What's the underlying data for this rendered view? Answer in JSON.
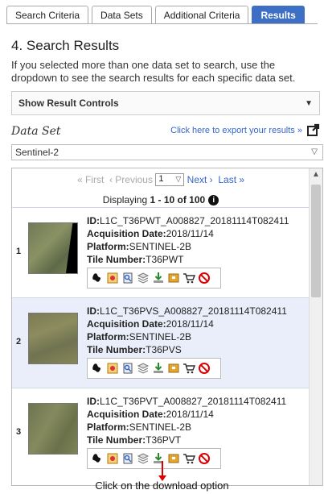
{
  "tabs": [
    {
      "label": "Search Criteria",
      "active": false
    },
    {
      "label": "Data Sets",
      "active": false
    },
    {
      "label": "Additional Criteria",
      "active": false
    },
    {
      "label": "Results",
      "active": true
    }
  ],
  "heading": "4. Search Results",
  "intro": "If you selected more than one data set to search, use the dropdown to see the search results for each specific data set.",
  "result_controls_label": "Show Result Controls",
  "dataset": {
    "label": "Data Set",
    "export_link": "Click here to export your results »",
    "selected": "Sentinel-2"
  },
  "pager": {
    "first": "« First",
    "previous": "‹ Previous",
    "page": "1",
    "next": "Next ›",
    "last": "Last »",
    "displaying_prefix": "Displaying ",
    "displaying_range": "1 - 10 of 100",
    "info_glyph": "i"
  },
  "results": [
    {
      "num": "1",
      "id_label": "ID:",
      "id": "L1C_T36PWT_A008827_20181114T082411",
      "date_label": "Acquisition Date:",
      "date": "2018/11/14",
      "platform_label": "Platform:",
      "platform": "SENTINEL-2B",
      "tile_label": "Tile Number:",
      "tile": "T36PWT",
      "selected": false
    },
    {
      "num": "2",
      "id_label": "ID:",
      "id": "L1C_T36PVS_A008827_20181114T082411",
      "date_label": "Acquisition Date:",
      "date": "2018/11/14",
      "platform_label": "Platform:",
      "platform": "SENTINEL-2B",
      "tile_label": "Tile Number:",
      "tile": "T36PVS",
      "selected": true
    },
    {
      "num": "3",
      "id_label": "ID:",
      "id": "L1C_T36PVT_A008827_20181114T082411",
      "date_label": "Acquisition Date:",
      "date": "2018/11/14",
      "platform_label": "Platform:",
      "platform": "SENTINEL-2B",
      "tile_label": "Tile Number:",
      "tile": "T36PVT",
      "selected": false
    }
  ],
  "tool_icons": [
    "footprint-icon",
    "metadata-icon",
    "compare-icon",
    "overlay-icon",
    "download-icon",
    "bulk-download-icon",
    "order-cart-icon",
    "exclude-icon"
  ],
  "caption": "Click on the download option",
  "colors": {
    "accent": "#3d6fc4",
    "link": "#3366cc",
    "annotation": "#d00000",
    "selected_row": "#e9eefa"
  }
}
